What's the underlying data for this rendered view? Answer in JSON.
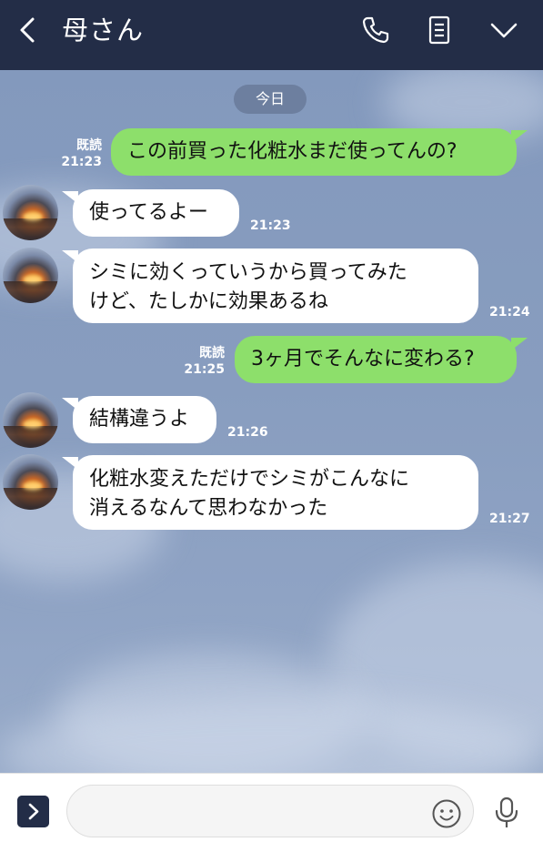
{
  "header": {
    "title": "母さん",
    "icons": [
      "back-icon",
      "phone-icon",
      "notes-icon",
      "chevron-down-icon"
    ]
  },
  "chat": {
    "date_label": "今日",
    "messages": [
      {
        "sender": "me",
        "text_lines": [
          "この前買った化粧水まだ使ってんの?"
        ],
        "read": "既読",
        "time": "21:23"
      },
      {
        "sender": "mom",
        "text_lines": [
          "使ってるよー"
        ],
        "time": "21:23"
      },
      {
        "sender": "mom",
        "text_lines": [
          "シミに効くっていうから買ってみた",
          "けど、たしかに効果あるね"
        ],
        "time": "21:24"
      },
      {
        "sender": "me",
        "text_lines": [
          "3ヶ月でそんなに変わる?"
        ],
        "read": "既読",
        "time": "21:25"
      },
      {
        "sender": "mom",
        "text_lines": [
          "結構違うよ"
        ],
        "time": "21:26"
      },
      {
        "sender": "mom",
        "text_lines": [
          "化粧水変えただけでシミがこんなに",
          "消えるなんて思わなかった"
        ],
        "time": "21:27"
      }
    ]
  },
  "input": {
    "placeholder": "",
    "value": ""
  },
  "colors": {
    "header_bg": "#232d47",
    "chat_bg": "#8a9ec0",
    "outgoing_bubble": "#8ddf6b",
    "incoming_bubble": "#ffffff"
  }
}
